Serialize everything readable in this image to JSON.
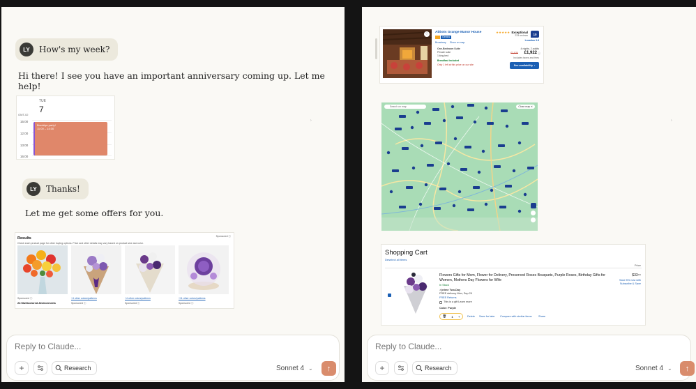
{
  "left": {
    "user_message_1": "How's my week?",
    "assistant_message_1": "Hi there! I see you have an important anniversary coming up. Let me help!",
    "calendar": {
      "day": "TUE",
      "date": "7",
      "timezone": "GMT-02",
      "hours": [
        "15:00",
        "12:00",
        "13:00",
        "16:00"
      ],
      "event_title": "Brooklyn party!",
      "event_time": "11:00 – 14:30"
    },
    "user_message_2": "Thanks!",
    "assistant_message_2": "Let me get some offers for you.",
    "results": {
      "title": "Results",
      "subtitle": "Check each product page for other buying options. Price and other details may vary based on product size and color.",
      "sponsored": "Sponsored ⓘ",
      "products": [
        {
          "link": "",
          "small": "Sponsored ⓘ",
          "name": "24 Multicolored Alstroemeria"
        },
        {
          "link": "+4 other colors/patterns",
          "small": "Sponsored ⓘ",
          "name": ""
        },
        {
          "link": "+4 other colors/patterns",
          "small": "Sponsored ⓘ",
          "name": ""
        },
        {
          "link": "+11 other colors/patterns",
          "small": "Sponsored ⓘ",
          "name": ""
        }
      ]
    },
    "input": {
      "placeholder": "Reply to Claude...",
      "research": "Research",
      "model": "Sonnet 4"
    }
  },
  "right": {
    "hotel": {
      "name": "Abbots Grange Manor House",
      "stars": "★★★★★",
      "score_label": "Exceptional",
      "reviews": "233 reviews",
      "score": "10",
      "location_score": "Location 9.8",
      "area": "Broadway",
      "map_link": "Show on map",
      "room": "One-Bedroom Suite",
      "bed1": "Private suite",
      "bed2": "1 king bed",
      "breakfast": "Breakfast included",
      "urgency": "Only 1 left at this price on our site",
      "nights": "4 nights, 2 adults",
      "old_price": "£2,520",
      "price": "£1,922",
      "taxes": "Includes taxes and fees",
      "cta": "See availability",
      "tag": "Genius"
    },
    "map": {
      "search": "Search on map",
      "close": "Close map ✕"
    },
    "cart": {
      "title": "Shopping Cart",
      "deselect": "Deselect all items",
      "price_header": "Price",
      "product": "Flowers Gifts for Mom, Flower for Delivery, Preserved Roses Bouquets, Purple Roses, Birthday Gifts for Women, Mothers Day Flowers for Wife",
      "stock": "In Stock",
      "prime": "✓prime Two-Day",
      "delivery": "FREE delivery Mon, Sep 29",
      "returns": "FREE Returns",
      "gift": "This is a gift Learn more",
      "color": "Color: Purple",
      "qty": "1",
      "delete": "Delete",
      "save": "Save for later",
      "compare": "Compare with similar items",
      "share": "Share",
      "price": "$33⁹⁹",
      "subscribe": "Save 5% now with Subscribe & Save"
    },
    "input": {
      "placeholder": "Reply to Claude...",
      "research": "Research",
      "model": "Sonnet 4"
    }
  },
  "colors": {
    "accent": "#d98c6c",
    "background": "#faf9f5",
    "link": "#1a5fb4"
  }
}
